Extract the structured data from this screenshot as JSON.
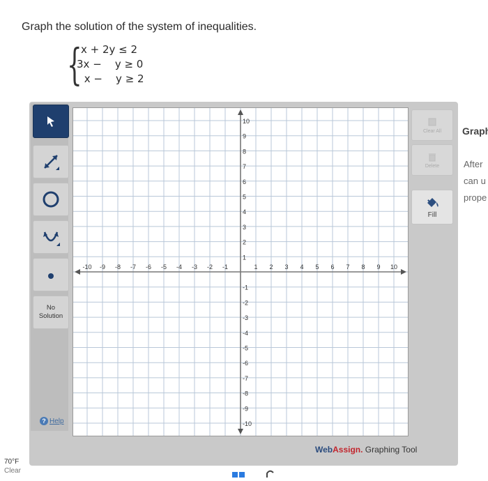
{
  "question": {
    "prompt": "Graph the solution of the system of inequalities.",
    "inequalities": [
      "x + 2y ≤ 2",
      "3x −    y ≥ 0",
      " x −    y ≥ 2"
    ]
  },
  "toolbar": {
    "no_solution_line1": "No",
    "no_solution_line2": "Solution",
    "help_label": "Help",
    "tools": [
      "pointer-tool",
      "line-tool",
      "circle-tool",
      "parabola-tool",
      "point-tool"
    ]
  },
  "right_toolbar": {
    "clear_all_label": "Clear All",
    "delete_label": "Delete",
    "fill_label": "Fill"
  },
  "graph": {
    "x_ticks": [
      "-10",
      "-9",
      "-8",
      "-7",
      "-6",
      "-5",
      "-4",
      "-3",
      "-2",
      "-1",
      "1",
      "2",
      "3",
      "4",
      "5",
      "6",
      "7",
      "8",
      "9",
      "10"
    ],
    "y_ticks": [
      "10",
      "9",
      "8",
      "7",
      "6",
      "5",
      "4",
      "3",
      "2",
      "1",
      "-1",
      "-2",
      "-3",
      "-4",
      "-5",
      "-6",
      "-7",
      "-8",
      "-9",
      "-10"
    ],
    "x_range": [
      -10,
      10
    ],
    "y_range": [
      -10,
      10
    ]
  },
  "brand": {
    "web": "Web",
    "assign": "Assign.",
    "tool": " Graphing Tool"
  },
  "side_panel": {
    "title": "Graph",
    "line1": "After",
    "line2": "can u",
    "line3": "prope"
  },
  "weather": {
    "temp": "70°F",
    "condition": "Clear"
  },
  "colors": {
    "active_tool": "#1f3f6e",
    "grid": "#b8c7d8",
    "axis": "#777777",
    "brand_blue": "#2b4c7e",
    "brand_red": "#c2262e"
  }
}
